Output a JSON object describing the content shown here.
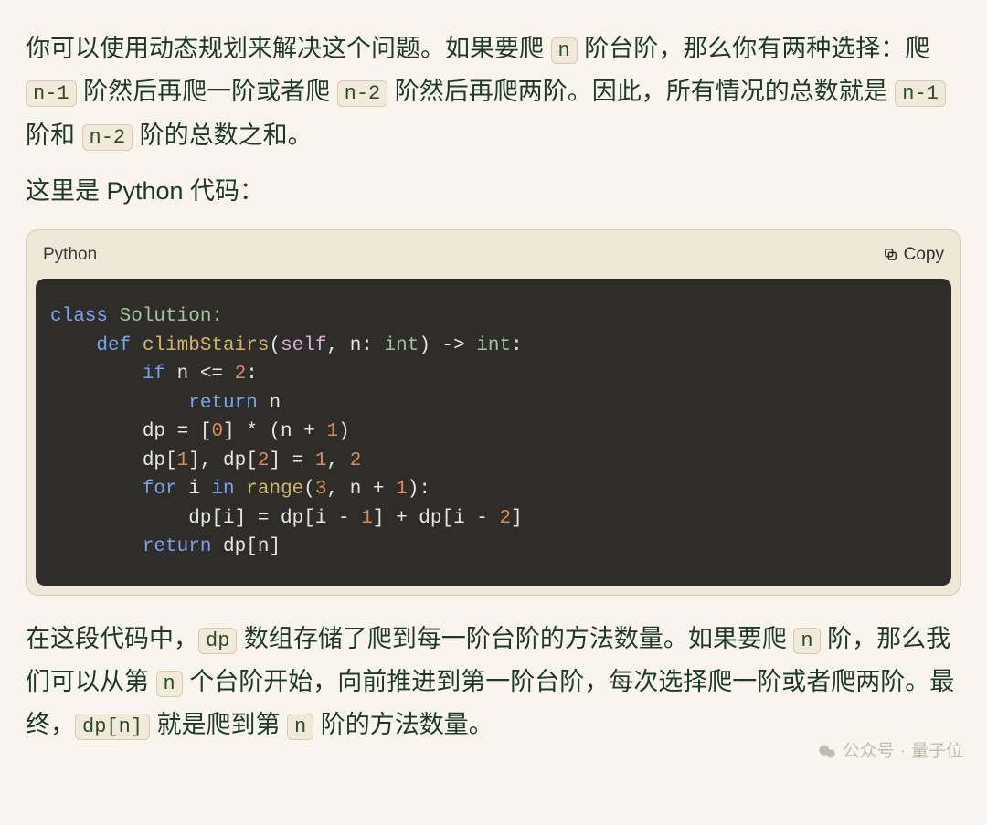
{
  "para1": {
    "t1": "你可以使用动态规划来解决这个问题。如果要爬 ",
    "c1": "n",
    "t2": " 阶台阶，那么你有两种选择：爬 ",
    "c2": "n-1",
    "t3": " 阶然后再爬一阶或者爬 ",
    "c3": "n-2",
    "t4": " 阶然后再爬两阶。因此，所有情况的总数就是 ",
    "c4": "n-1",
    "t5": " 阶和 ",
    "c5": "n-2",
    "t6": " 阶的总数之和。"
  },
  "para2": "这里是 Python 代码：",
  "code": {
    "lang": "Python",
    "copy": "Copy",
    "lines": {
      "l1a": "class",
      "l1b": " Solution:",
      "l2a": "    def",
      "l2b": " climbStairs",
      "l2c": "(",
      "l2d": "self",
      "l2e": ", n: ",
      "l2f": "int",
      "l2g": ") -> ",
      "l2h": "int",
      "l2i": ":",
      "l3a": "        if",
      "l3b": " n <= ",
      "l3c": "2",
      "l3d": ":",
      "l4a": "            return",
      "l4b": " n",
      "l5a": "        dp = [",
      "l5b": "0",
      "l5c": "] * (n + ",
      "l5d": "1",
      "l5e": ")",
      "l6a": "        dp[",
      "l6b": "1",
      "l6c": "], dp[",
      "l6d": "2",
      "l6e": "] = ",
      "l6f": "1",
      "l6g": ", ",
      "l6h": "2",
      "l7a": "        for",
      "l7b": " i ",
      "l7c": "in",
      "l7d": " ",
      "l7e": "range",
      "l7f": "(",
      "l7g": "3",
      "l7h": ", n + ",
      "l7i": "1",
      "l7j": "):",
      "l8a": "            dp[i] = dp[i - ",
      "l8b": "1",
      "l8c": "] + dp[i - ",
      "l8d": "2",
      "l8e": "]",
      "l9a": "        return",
      "l9b": " dp[n]"
    }
  },
  "para3": {
    "t1": "在这段代码中，",
    "c1": "dp",
    "t2": " 数组存储了爬到每一阶台阶的方法数量。如果要爬 ",
    "c2": "n",
    "t3": " 阶，那么我们可以从第 ",
    "c3": "n",
    "t4": " 个台阶开始，向前推进到第一阶台阶，每次选择爬一阶或者爬两阶。最终，",
    "c4": "dp[n]",
    "t5": " 就是爬到第 ",
    "c5": "n",
    "t6": " 阶的方法数量。"
  },
  "watermark": {
    "prefix": "公众号",
    "sep": " · ",
    "name": "量子位"
  }
}
